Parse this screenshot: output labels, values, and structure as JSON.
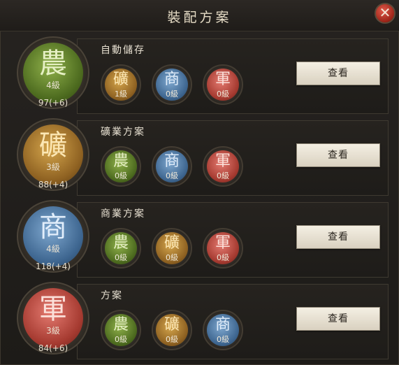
{
  "window": {
    "title": "裝配方案"
  },
  "plans": [
    {
      "name": "自動儲存",
      "main": {
        "glyph": "農",
        "type": "farm",
        "level": "4級",
        "points": "97(+6)"
      },
      "subs": [
        {
          "glyph": "礦",
          "type": "mine",
          "level": "1級"
        },
        {
          "glyph": "商",
          "type": "trade",
          "level": "0級"
        },
        {
          "glyph": "軍",
          "type": "army",
          "level": "0級"
        }
      ],
      "button": "查看"
    },
    {
      "name": "礦業方案",
      "main": {
        "glyph": "礦",
        "type": "mine",
        "level": "3級",
        "points": "88(+4)"
      },
      "subs": [
        {
          "glyph": "農",
          "type": "farm",
          "level": "0級"
        },
        {
          "glyph": "商",
          "type": "trade",
          "level": "0級"
        },
        {
          "glyph": "軍",
          "type": "army",
          "level": "0級"
        }
      ],
      "button": "查看"
    },
    {
      "name": "商業方案",
      "main": {
        "glyph": "商",
        "type": "trade",
        "level": "4級",
        "points": "118(+4)"
      },
      "subs": [
        {
          "glyph": "農",
          "type": "farm",
          "level": "0級"
        },
        {
          "glyph": "礦",
          "type": "mine",
          "level": "0級"
        },
        {
          "glyph": "軍",
          "type": "army",
          "level": "0級"
        }
      ],
      "button": "查看"
    },
    {
      "name": "方案",
      "main": {
        "glyph": "軍",
        "type": "army",
        "level": "3級",
        "points": "84(+6)"
      },
      "subs": [
        {
          "glyph": "農",
          "type": "farm",
          "level": "0級"
        },
        {
          "glyph": "礦",
          "type": "mine",
          "level": "0級"
        },
        {
          "glyph": "商",
          "type": "trade",
          "level": "0級"
        }
      ],
      "button": "查看"
    }
  ]
}
